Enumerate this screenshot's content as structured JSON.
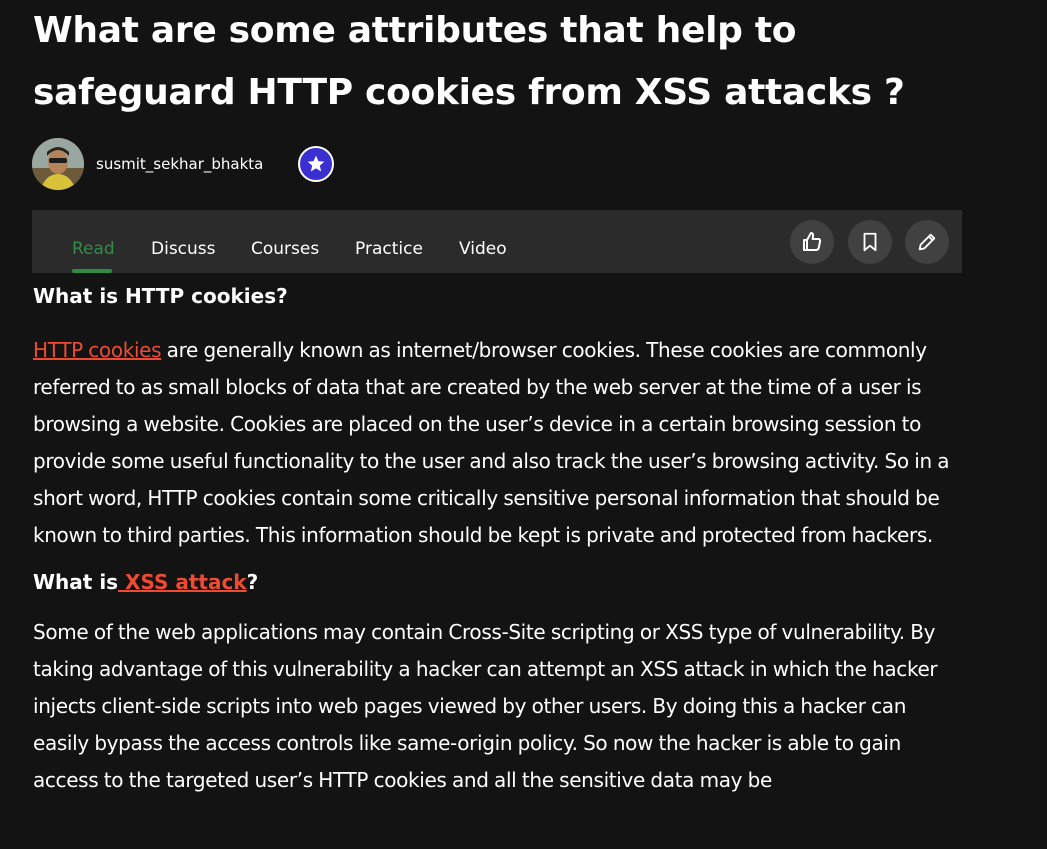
{
  "article": {
    "title": "What are some attributes that help to safeguard HTTP cookies from XSS attacks ?",
    "author": {
      "name": "susmit_sekhar_bhakta",
      "avatar_icon": "avatar",
      "badge_icon": "star-icon",
      "badge_color": "#3a2fd0"
    }
  },
  "tabs": [
    {
      "label": "Read",
      "active": true
    },
    {
      "label": "Discuss",
      "active": false
    },
    {
      "label": "Courses",
      "active": false
    },
    {
      "label": "Practice",
      "active": false
    },
    {
      "label": "Video",
      "active": false
    }
  ],
  "actions": {
    "like_icon": "thumbs-up-icon",
    "bookmark_icon": "bookmark-icon",
    "edit_icon": "pencil-icon"
  },
  "colors": {
    "background": "#131313",
    "tabbar": "#2b2b2b",
    "accent_green": "#2f8d46",
    "link": "#ef4b32"
  },
  "sections": {
    "s1_heading": "What is HTTP cookies?",
    "s1_link": "HTTP cookies",
    "s1_text": " are generally known as internet/browser cookies. These cookies are commonly referred to as small blocks of data that are created by the web server at the time of a user is browsing a website. Cookies are placed on the user’s device in a certain browsing session to provide some useful functionality to the user and also track the user’s browsing activity. So in a short word, HTTP cookies contain some critically sensitive personal information that should be known to third parties. This information should be kept is private and protected from hackers.",
    "s2_heading_prefix": "What is",
    "s2_heading_link": " XSS attack",
    "s2_heading_suffix": "?",
    "s2_text": "Some of the web applications may contain Cross-Site scripting or XSS type of vulnerability. By taking advantage of this vulnerability a hacker can attempt an XSS attack in which the hacker injects client-side scripts into web pages viewed by other users. By doing this a hacker can easily bypass the access controls like same-origin policy. So now the hacker is able to gain access to the targeted user’s HTTP cookies and all the sensitive data may be"
  }
}
